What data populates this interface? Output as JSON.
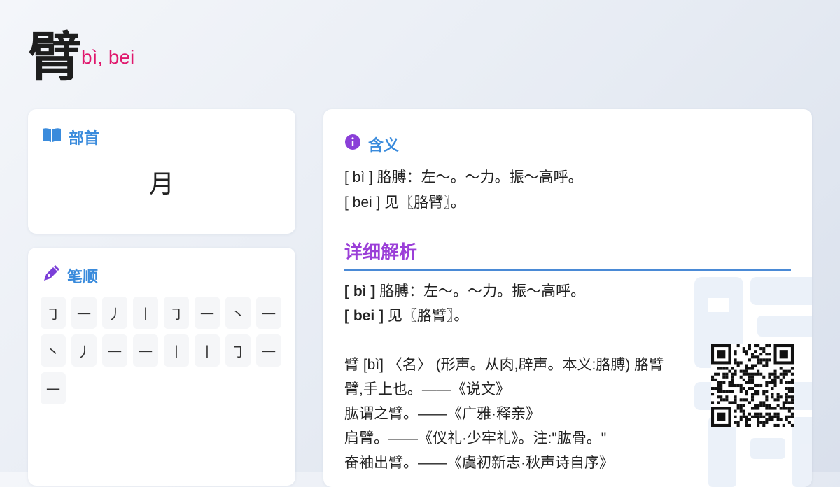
{
  "header": {
    "character": "臂",
    "pinyin": "bì, bei"
  },
  "radical": {
    "title": "部首",
    "icon": "book-icon",
    "value": "月"
  },
  "strokes": {
    "title": "笔顺",
    "icon": "pen-icon",
    "items": [
      "㇆",
      "一",
      "丿",
      "丨",
      "㇆",
      "一",
      "丶",
      "一",
      "丶",
      "丿",
      "一",
      "一",
      "丨",
      "丨",
      "㇆",
      "一",
      "一"
    ]
  },
  "meaning": {
    "title": "含义",
    "icon": "info-icon",
    "lines": [
      "[ bì ] 胳膊：左～。～力。振～高呼。",
      "[ bei ] 见〖胳臂〗。"
    ]
  },
  "detail": {
    "title": "详细解析",
    "entries": [
      {
        "label": "[ bì ]",
        "text": " 胳膊：左～。～力。振～高呼。"
      },
      {
        "label": "[ bei ]",
        "text": " 见〖胳臂〗。"
      }
    ],
    "lines": [
      "臂 [bì] 〈名〉 (形声。从肉,辟声。本义:胳膊) 胳臂",
      "臂,手上也。——《说文》",
      "肱谓之臂。——《广雅·释亲》",
      "肩臂。——《仪礼·少牢礼》。注:\"肱骨。\"",
      "奋袖出臂。——《虞初新志·秋声诗自序》"
    ]
  },
  "colors": {
    "accent_blue": "#3a8bdc",
    "accent_purple": "#9b3fd8",
    "pinyin_pink": "#e0186d"
  }
}
